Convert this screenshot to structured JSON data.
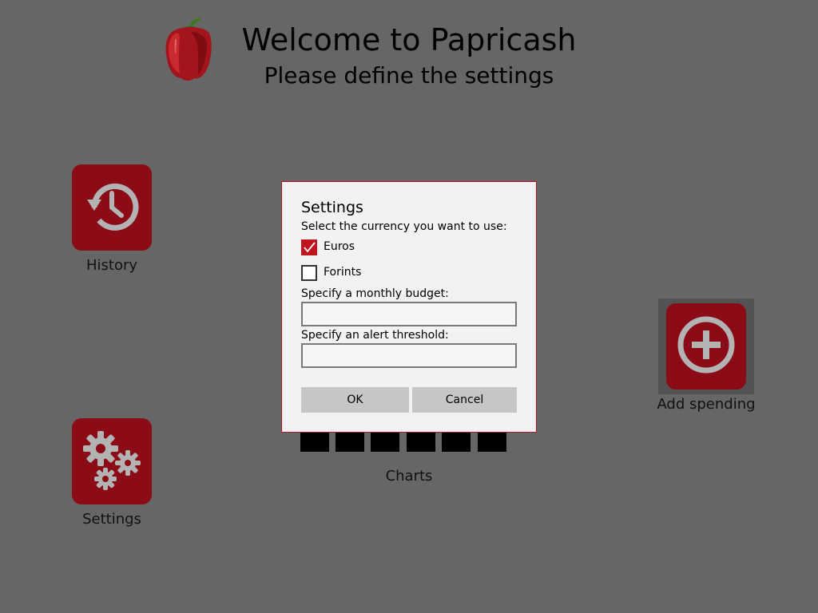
{
  "header": {
    "logo_icon": "pepper-icon",
    "title": "Welcome to Papricash",
    "subtitle": "Please define the settings"
  },
  "tiles": {
    "history": {
      "label": "History",
      "icon": "history-icon"
    },
    "settings": {
      "label": "Settings",
      "icon": "gears-icon"
    },
    "add_spending": {
      "label": "Add spending",
      "icon": "plus-circle-icon"
    },
    "charts": {
      "label": "Charts",
      "icon": "bar-chart-icon"
    }
  },
  "dialog": {
    "title": "Settings",
    "currency_prompt": "Select the currency you want to use:",
    "currencies": [
      {
        "label": "Euros",
        "checked": true
      },
      {
        "label": "Forints",
        "checked": false
      }
    ],
    "budget_label": "Specify a monthly budget:",
    "budget_value": "",
    "threshold_label": "Specify an alert threshold:",
    "threshold_value": "",
    "ok_label": "OK",
    "cancel_label": "Cancel"
  },
  "colors": {
    "background": "#666666",
    "tile": "#8b0c16",
    "accent": "#c0151f",
    "dialog": "#f2f2f2"
  }
}
